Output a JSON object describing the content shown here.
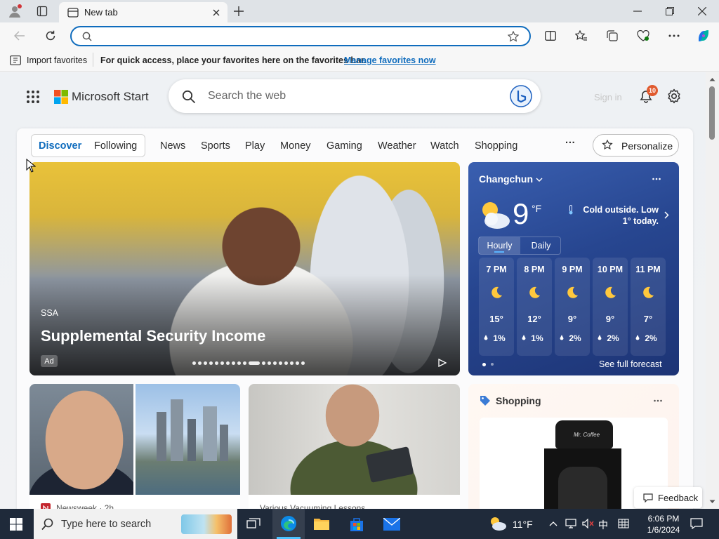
{
  "browser": {
    "tab_title": "New tab",
    "address_value": "",
    "favorites_bar": {
      "import_label": "Import favorites",
      "message": "For quick access, place your favorites here on the favorites bar.",
      "manage_link": "Manage favorites now"
    }
  },
  "header": {
    "logo_text": "Microsoft Start",
    "search_placeholder": "Search the web",
    "sign_in": "Sign in",
    "notification_count": "10"
  },
  "nav": {
    "tabs": [
      "Discover",
      "Following"
    ],
    "items": [
      "News",
      "Sports",
      "Play",
      "Money",
      "Gaming",
      "Weather",
      "Watch",
      "Shopping"
    ],
    "more": "···",
    "personalize": "Personalize"
  },
  "hero": {
    "source": "SSA",
    "title": "Supplemental Security Income",
    "ad_badge": "Ad",
    "slide_count": 19,
    "active_slide": 10
  },
  "weather": {
    "city": "Changchun",
    "temp": "9",
    "unit": "°F",
    "summary": "Cold outside. Low 1° today.",
    "tabs": [
      "Hourly",
      "Daily"
    ],
    "hourly": [
      {
        "time": "7 PM",
        "temp": "15°",
        "precip": "1%"
      },
      {
        "time": "8 PM",
        "temp": "12°",
        "precip": "1%"
      },
      {
        "time": "9 PM",
        "temp": "9°",
        "precip": "2%"
      },
      {
        "time": "10 PM",
        "temp": "9°",
        "precip": "2%"
      },
      {
        "time": "11 PM",
        "temp": "7°",
        "precip": "2%"
      }
    ],
    "see_forecast": "See full forecast"
  },
  "cards": {
    "card1_source": "Newsweek · 2h",
    "card2_source": "Various Vacuuming Lessons"
  },
  "shopping": {
    "title": "Shopping",
    "product_brand": "Mr. Coffee"
  },
  "feedback_label": "Feedback",
  "taskbar": {
    "search_placeholder": "Type here to search",
    "weather_temp": "11°F",
    "ime": "中",
    "time": "6:06 PM",
    "date": "1/6/2024"
  },
  "colors": {
    "accent": "#0f6cbd",
    "weather_bg": "#274690",
    "taskbar_bg": "#1f2a3a"
  }
}
